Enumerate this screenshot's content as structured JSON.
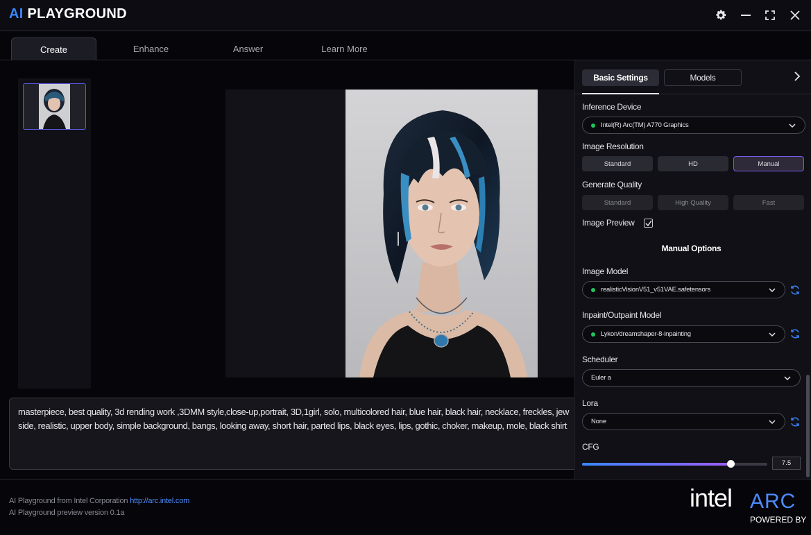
{
  "app": {
    "logo_ai": "AI",
    "logo_rest": " PLAYGROUND"
  },
  "window_controls": [
    "gear-icon",
    "minimize-icon",
    "maximize-icon",
    "close-icon"
  ],
  "tabs": [
    {
      "label": "Create",
      "active": true
    },
    {
      "label": "Enhance",
      "active": false
    },
    {
      "label": "Answer",
      "active": false
    },
    {
      "label": "Learn More",
      "active": false
    }
  ],
  "prompt": {
    "line1": "masterpiece, best quality, 3d rending work ,3DMM style,close-up,portrait, 3D,1girl, solo, multicolored hair, blue hair, black hair, necklace, freckles, jew",
    "line2": "side, realistic, upper body, simple background, bangs, looking away, short hair, parted lips, black eyes, lips, gothic, choker, makeup, mole, black shirt"
  },
  "footer": {
    "credit": "AI Playground from Intel Corporation",
    "link": "http://arc.intel.com",
    "version": "AI Playground preview version 0.1a",
    "brand_intel": "intel",
    "brand_arc": "ARC",
    "powered_by": "POWERED BY"
  },
  "settings": {
    "tab_basic": "Basic Settings",
    "tab_models": "Models",
    "inference_device": {
      "label": "Inference Device",
      "value": "Intel(R) Arc(TM) A770 Graphics"
    },
    "image_resolution": {
      "label": "Image Resolution",
      "options": [
        "Standard",
        "HD",
        "Manual"
      ],
      "selected": "Manual"
    },
    "generate_quality": {
      "label": "Generate Quality",
      "options": [
        "Standard",
        "High Quality",
        "Fast"
      ]
    },
    "image_preview": {
      "label": "Image Preview",
      "checked": true
    },
    "manual_options_title": "Manual Options",
    "image_model": {
      "label": "Image Model",
      "value": "realisticVisionV51_v51VAE.safetensors"
    },
    "inpaint_model": {
      "label": "Inpaint/Outpaint Model",
      "value": "Lykon/dreamshaper-8-inpainting"
    },
    "scheduler": {
      "label": "Scheduler",
      "value": "Euler a"
    },
    "lora": {
      "label": "Lora",
      "value": "None"
    },
    "cfg": {
      "label": "CFG",
      "value": "7.5",
      "fill_fraction": 0.8
    }
  },
  "colors": {
    "accent_blue": "#3a86ff",
    "accent_purple": "#9b5cf6",
    "status_green": "#22c55e"
  }
}
